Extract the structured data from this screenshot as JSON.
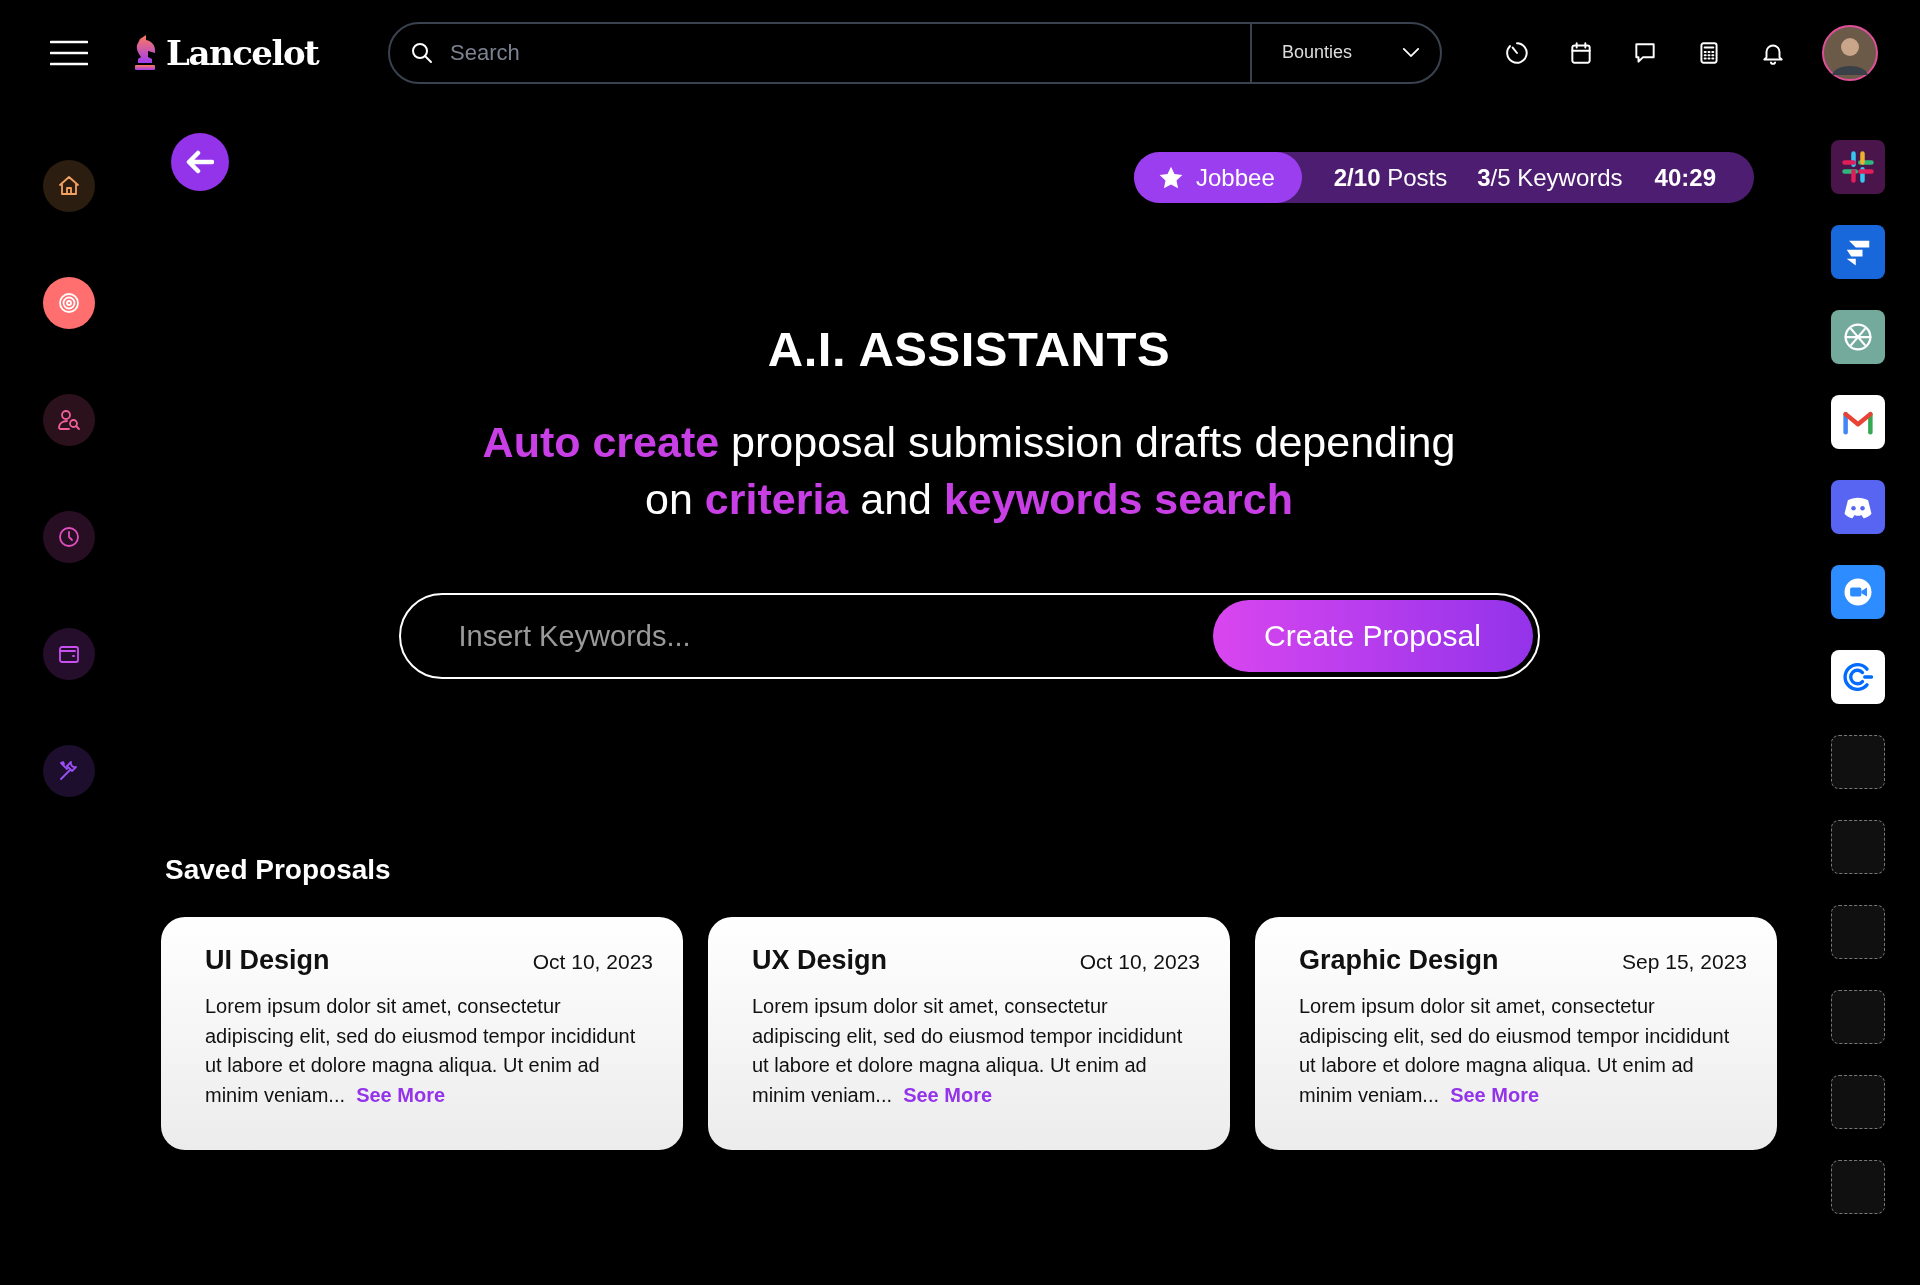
{
  "topbar": {
    "brand": "Lancelot",
    "search": {
      "placeholder": "Search"
    },
    "filter": {
      "value": "Bounties"
    }
  },
  "sidebar": {
    "items": [
      {
        "selected": false,
        "color": "#f4a261"
      },
      {
        "selected": true,
        "color": "#ff6f6f"
      },
      {
        "selected": false,
        "color": "#f0609a"
      },
      {
        "selected": false,
        "color": "#e04fc0"
      },
      {
        "selected": false,
        "color": "#c94ff0"
      },
      {
        "selected": false,
        "color": "#9b4ff5"
      }
    ]
  },
  "status": {
    "account": "Jobbee",
    "stats": [
      "**2/10** Posts",
      "**3**/5 Keywords"
    ],
    "timer": "40:29"
  },
  "hero": {
    "title": "A.I. ASSISTANTS",
    "subtitle_lines": [
      [
        {
          "text": "Auto create",
          "highlight": true
        },
        {
          "text": " proposal submission drafts depending",
          "highlight": false
        }
      ],
      [
        {
          "text": "on ",
          "highlight": false
        },
        {
          "text": "criteria",
          "highlight": true
        },
        {
          "text": " and ",
          "highlight": false
        },
        {
          "text": "keywords search",
          "highlight": true
        }
      ]
    ]
  },
  "keyword_input": {
    "placeholder": "Insert Keywords...",
    "button": "Create Proposal"
  },
  "saved": {
    "heading": "Saved Proposals",
    "cards": [
      {
        "title": "UI Design",
        "date": "Oct 10, 2023",
        "body": "Lorem ipsum dolor sit amet, consectetur adipiscing elit, sed do eiusmod tempor incididunt ut labore et dolore magna aliqua. Ut enim ad minim veniam...",
        "link": "See More"
      },
      {
        "title": "UX Design",
        "date": "Oct 10, 2023",
        "body": "Lorem ipsum dolor sit amet, consectetur adipiscing elit, sed do eiusmod tempor incididunt ut labore et dolore magna aliqua. Ut enim ad minim veniam...",
        "link": "See More"
      },
      {
        "title": "Graphic Design",
        "date": "Sep 15, 2023",
        "body": "Lorem ipsum dolor sit amet, consectetur adipiscing elit, sed do eiusmod tempor incididunt ut labore et dolore magna aliqua. Ut enim ad minim veniam...",
        "link": "See More"
      }
    ]
  },
  "apps": [
    {
      "kind": "app",
      "color": "#4a154b"
    },
    {
      "kind": "app",
      "color": "#1868db"
    },
    {
      "kind": "app",
      "color": "#74aa9c"
    },
    {
      "kind": "app",
      "color": "#ffffff"
    },
    {
      "kind": "app",
      "color": "#5865f2"
    },
    {
      "kind": "app",
      "color": "#2d8cff"
    },
    {
      "kind": "app",
      "color": "#ffffff"
    },
    {
      "kind": "empty"
    },
    {
      "kind": "empty"
    },
    {
      "kind": "empty"
    },
    {
      "kind": "empty"
    },
    {
      "kind": "empty"
    },
    {
      "kind": "empty"
    }
  ]
}
